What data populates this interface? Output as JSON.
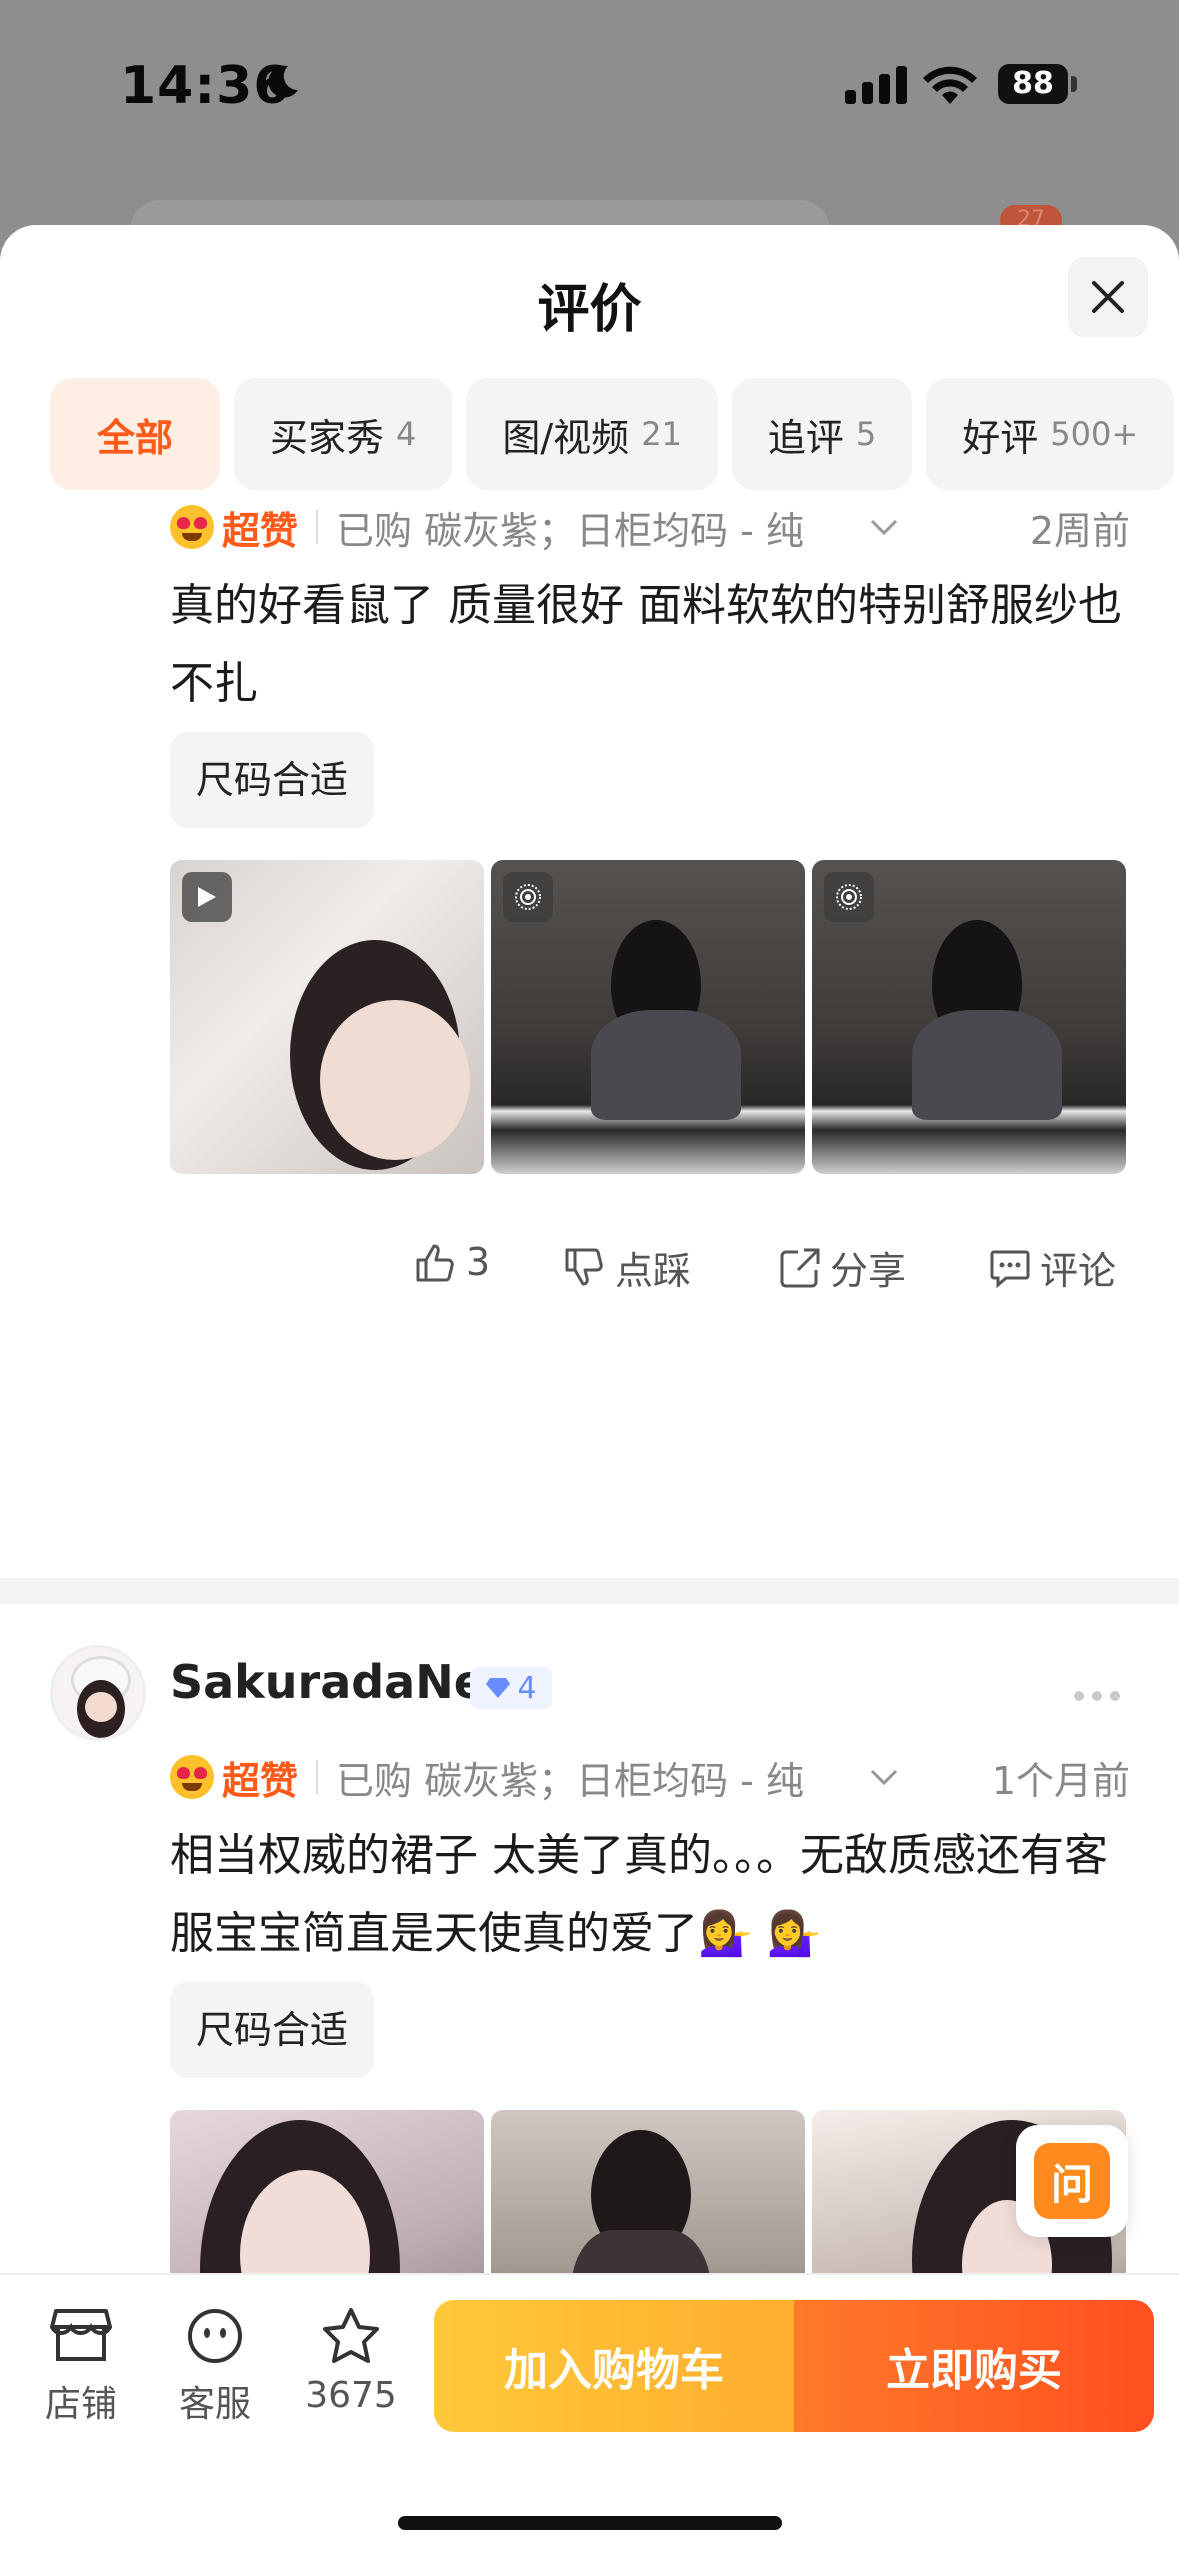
{
  "status": {
    "time": "14:36",
    "battery": "88"
  },
  "background": {
    "cart_count": "27"
  },
  "sheet": {
    "title": "评价"
  },
  "tabs": [
    {
      "label": "全部",
      "count": ""
    },
    {
      "label": "买家秀",
      "count": "4"
    },
    {
      "label": "图/视频",
      "count": "21"
    },
    {
      "label": "追评",
      "count": "5"
    },
    {
      "label": "好评",
      "count": "500+"
    }
  ],
  "reviews": [
    {
      "rating": "超赞",
      "purchased": "已购 碳灰紫；日柜均码 - 纯",
      "date": "2周前",
      "text": "真的好看鼠了 质量很好 面料软软的特别舒服纱也不扎",
      "tag": "尺码合适",
      "likes": "3",
      "dislike_label": "点踩",
      "share_label": "分享",
      "comment_label": "评论"
    },
    {
      "username": "SakuradaNe",
      "vip_level": "4",
      "rating": "超赞",
      "purchased": "已购 碳灰紫；日柜均码 - 纯",
      "date": "1个月前",
      "text": "相当权威的裙子 太美了真的。。。无敌质感还有客服宝宝简直是天使真的爱了💁‍♀️ 💁‍♀️",
      "tag": "尺码合适"
    }
  ],
  "ask_button": "问",
  "bottom": {
    "shop_label": "店铺",
    "service_label": "客服",
    "fav_count": "3675",
    "add_cart_label": "加入购物车",
    "buy_label": "立即购买"
  },
  "colors": {
    "accent": "#ff5a1a",
    "cart_yellow": "#ffbe34",
    "buy_orange": "#ff5a22"
  }
}
